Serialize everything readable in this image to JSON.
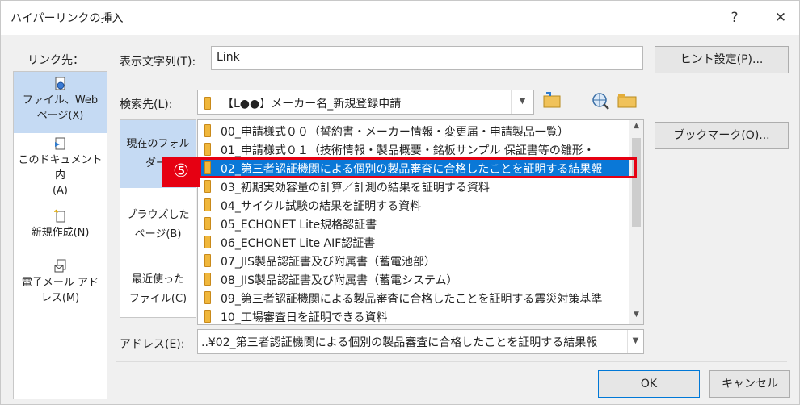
{
  "dialog": {
    "title": "ハイパーリンクの挿入",
    "help_label": "?",
    "close_label": "✕"
  },
  "link_to": {
    "label": "リンク先：",
    "items": [
      {
        "label_line1": "ファイル、Web",
        "label_line2": "ページ(X)",
        "icon": "file-web-icon",
        "selected": true
      },
      {
        "label_line1": "このドキュメント内",
        "label_line2": "(A)",
        "icon": "document-place-icon",
        "selected": false
      },
      {
        "label_line1": "新規作成(N)",
        "label_line2": "",
        "icon": "new-document-icon",
        "selected": false
      },
      {
        "label_line1": "電子メール アド",
        "label_line2": "レス(M)",
        "icon": "email-icon",
        "selected": false
      }
    ]
  },
  "display_text": {
    "label": "表示文字列(T):",
    "value": "Link"
  },
  "hint_button": "ヒント設定(P)...",
  "look_in": {
    "label": "検索先(L):",
    "value": "【L●●】メーカー名_新規登録申請"
  },
  "subnav": {
    "items": [
      {
        "line1": "現在のフォル",
        "line2": "ダー(",
        "selected": true
      },
      {
        "line1": "ブラウズした",
        "line2": "ページ(B)",
        "selected": false
      },
      {
        "line1": "最近使った",
        "line2": "ファイル(C)",
        "selected": false
      }
    ]
  },
  "files": [
    {
      "name": "00_申請様式００（誓約書・メーカー情報・変更届・申請製品一覧）",
      "selected": false
    },
    {
      "name": "01_申請様式０１（技術情報・製品概要・銘板サンプル 保証書等の雛形・",
      "selected": false
    },
    {
      "name": "02_第三者認証機関による個別の製品審査に合格したことを証明する結果報",
      "selected": true
    },
    {
      "name": "03_初期実効容量の計算／計測の結果を証明する資料",
      "selected": false
    },
    {
      "name": "04_サイクル試験の結果を証明する資料",
      "selected": false
    },
    {
      "name": "05_ECHONET Lite規格認証書",
      "selected": false
    },
    {
      "name": "06_ECHONET Lite AIF認証書",
      "selected": false
    },
    {
      "name": "07_JIS製品認証書及び附属書（蓄電池部）",
      "selected": false
    },
    {
      "name": "08_JIS製品認証書及び附属書（蓄電システム）",
      "selected": false
    },
    {
      "name": "09_第三者認証機関による製品審査に合格したことを証明する震災対策基準",
      "selected": false
    },
    {
      "name": "10_工場審査日を証明できる資料",
      "selected": false
    }
  ],
  "bookmark_button": "ブックマーク(O)...",
  "step_badge": "⑤",
  "address": {
    "label": "アドレス(E):",
    "value": "..¥02_第三者認証機関による個別の製品審査に合格したことを証明する結果報"
  },
  "ok_button": "OK",
  "cancel_button": "キャンセル",
  "colors": {
    "selection": "#0a78d7",
    "highlight_border": "#e60012",
    "nav_selected": "#c5daf3"
  }
}
